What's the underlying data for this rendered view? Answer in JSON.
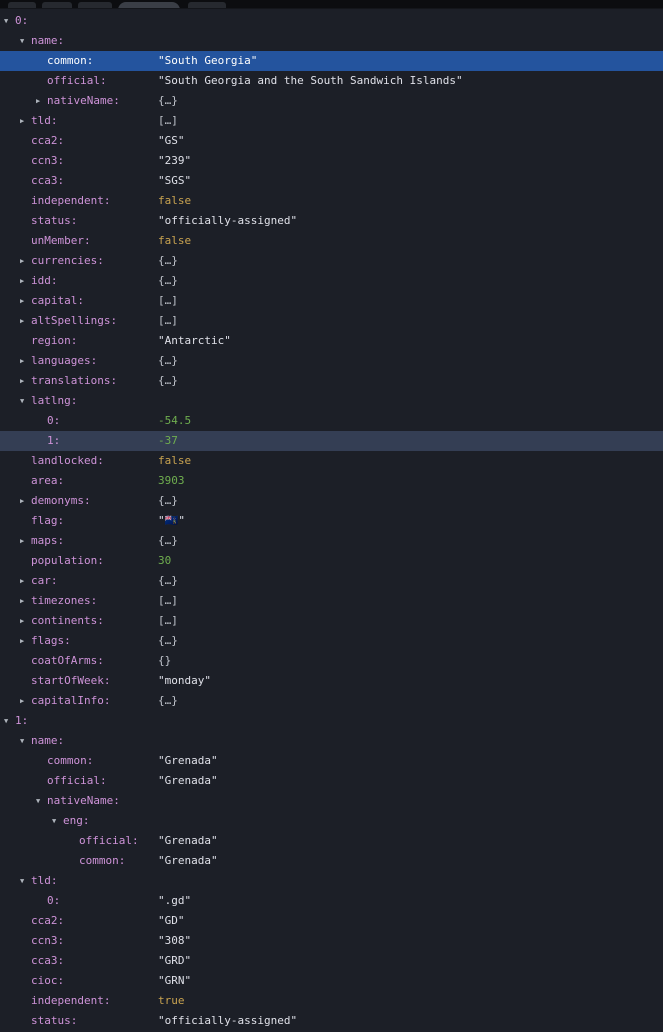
{
  "colors": {
    "background": "#1c1f27",
    "toolbar_background": "#0c0d10",
    "key": "#ce93d8",
    "string": "#dfe0e8",
    "number": "#6fae4f",
    "boolean": "#c9a350",
    "object_placeholder": "#c2c6ce",
    "selection_primary": "#24549e",
    "selection_secondary": "#343e54"
  },
  "icons": {
    "expanded": "▼",
    "collapsed": "▶"
  },
  "tree": {
    "rows": [
      {
        "depth": 0,
        "expander": "open",
        "key": "0:",
        "value": "",
        "type": "none",
        "selected": null
      },
      {
        "depth": 1,
        "expander": "open",
        "key": "name:",
        "value": "",
        "type": "none",
        "selected": null
      },
      {
        "depth": 2,
        "expander": "none",
        "key": "common:",
        "value": "\"South Georgia\"",
        "type": "string",
        "selected": "primary"
      },
      {
        "depth": 2,
        "expander": "none",
        "key": "official:",
        "value": "\"South Georgia and the South Sandwich Islands\"",
        "type": "string",
        "selected": null
      },
      {
        "depth": 2,
        "expander": "closed",
        "key": "nativeName:",
        "value": "{…}",
        "type": "object",
        "selected": null
      },
      {
        "depth": 1,
        "expander": "closed",
        "key": "tld:",
        "value": "[…]",
        "type": "array",
        "selected": null
      },
      {
        "depth": 1,
        "expander": "none",
        "key": "cca2:",
        "value": "\"GS\"",
        "type": "string",
        "selected": null
      },
      {
        "depth": 1,
        "expander": "none",
        "key": "ccn3:",
        "value": "\"239\"",
        "type": "string",
        "selected": null
      },
      {
        "depth": 1,
        "expander": "none",
        "key": "cca3:",
        "value": "\"SGS\"",
        "type": "string",
        "selected": null
      },
      {
        "depth": 1,
        "expander": "none",
        "key": "independent:",
        "value": "false",
        "type": "boolean",
        "selected": null
      },
      {
        "depth": 1,
        "expander": "none",
        "key": "status:",
        "value": "\"officially-assigned\"",
        "type": "string",
        "selected": null
      },
      {
        "depth": 1,
        "expander": "none",
        "key": "unMember:",
        "value": "false",
        "type": "boolean",
        "selected": null
      },
      {
        "depth": 1,
        "expander": "closed",
        "key": "currencies:",
        "value": "{…}",
        "type": "object",
        "selected": null
      },
      {
        "depth": 1,
        "expander": "closed",
        "key": "idd:",
        "value": "{…}",
        "type": "object",
        "selected": null
      },
      {
        "depth": 1,
        "expander": "closed",
        "key": "capital:",
        "value": "[…]",
        "type": "array",
        "selected": null
      },
      {
        "depth": 1,
        "expander": "closed",
        "key": "altSpellings:",
        "value": "[…]",
        "type": "array",
        "selected": null
      },
      {
        "depth": 1,
        "expander": "none",
        "key": "region:",
        "value": "\"Antarctic\"",
        "type": "string",
        "selected": null
      },
      {
        "depth": 1,
        "expander": "closed",
        "key": "languages:",
        "value": "{…}",
        "type": "object",
        "selected": null
      },
      {
        "depth": 1,
        "expander": "closed",
        "key": "translations:",
        "value": "{…}",
        "type": "object",
        "selected": null
      },
      {
        "depth": 1,
        "expander": "open",
        "key": "latlng:",
        "value": "",
        "type": "none",
        "selected": null
      },
      {
        "depth": 2,
        "expander": "none",
        "key": "0:",
        "value": "-54.5",
        "type": "number",
        "selected": null
      },
      {
        "depth": 2,
        "expander": "none",
        "key": "1:",
        "value": "-37",
        "type": "number",
        "selected": "secondary"
      },
      {
        "depth": 1,
        "expander": "none",
        "key": "landlocked:",
        "value": "false",
        "type": "boolean",
        "selected": null
      },
      {
        "depth": 1,
        "expander": "none",
        "key": "area:",
        "value": "3903",
        "type": "number",
        "selected": null
      },
      {
        "depth": 1,
        "expander": "closed",
        "key": "demonyms:",
        "value": "{…}",
        "type": "object",
        "selected": null
      },
      {
        "depth": 1,
        "expander": "none",
        "key": "flag:",
        "value": "\"🇬🇸\"",
        "type": "string",
        "selected": null
      },
      {
        "depth": 1,
        "expander": "closed",
        "key": "maps:",
        "value": "{…}",
        "type": "object",
        "selected": null
      },
      {
        "depth": 1,
        "expander": "none",
        "key": "population:",
        "value": "30",
        "type": "number",
        "selected": null
      },
      {
        "depth": 1,
        "expander": "closed",
        "key": "car:",
        "value": "{…}",
        "type": "object",
        "selected": null
      },
      {
        "depth": 1,
        "expander": "closed",
        "key": "timezones:",
        "value": "[…]",
        "type": "array",
        "selected": null
      },
      {
        "depth": 1,
        "expander": "closed",
        "key": "continents:",
        "value": "[…]",
        "type": "array",
        "selected": null
      },
      {
        "depth": 1,
        "expander": "closed",
        "key": "flags:",
        "value": "{…}",
        "type": "object",
        "selected": null
      },
      {
        "depth": 1,
        "expander": "none",
        "key": "coatOfArms:",
        "value": "{}",
        "type": "object",
        "selected": null
      },
      {
        "depth": 1,
        "expander": "none",
        "key": "startOfWeek:",
        "value": "\"monday\"",
        "type": "string",
        "selected": null
      },
      {
        "depth": 1,
        "expander": "closed",
        "key": "capitalInfo:",
        "value": "{…}",
        "type": "object",
        "selected": null
      },
      {
        "depth": 0,
        "expander": "open",
        "key": "1:",
        "value": "",
        "type": "none",
        "selected": null
      },
      {
        "depth": 1,
        "expander": "open",
        "key": "name:",
        "value": "",
        "type": "none",
        "selected": null
      },
      {
        "depth": 2,
        "expander": "none",
        "key": "common:",
        "value": "\"Grenada\"",
        "type": "string",
        "selected": null
      },
      {
        "depth": 2,
        "expander": "none",
        "key": "official:",
        "value": "\"Grenada\"",
        "type": "string",
        "selected": null
      },
      {
        "depth": 2,
        "expander": "open",
        "key": "nativeName:",
        "value": "",
        "type": "none",
        "selected": null
      },
      {
        "depth": 3,
        "expander": "open",
        "key": "eng:",
        "value": "",
        "type": "none",
        "selected": null
      },
      {
        "depth": 4,
        "expander": "none",
        "key": "official:",
        "value": "\"Grenada\"",
        "type": "string",
        "selected": null
      },
      {
        "depth": 4,
        "expander": "none",
        "key": "common:",
        "value": "\"Grenada\"",
        "type": "string",
        "selected": null
      },
      {
        "depth": 1,
        "expander": "open",
        "key": "tld:",
        "value": "",
        "type": "none",
        "selected": null
      },
      {
        "depth": 2,
        "expander": "none",
        "key": "0:",
        "value": "\".gd\"",
        "type": "string",
        "selected": null
      },
      {
        "depth": 1,
        "expander": "none",
        "key": "cca2:",
        "value": "\"GD\"",
        "type": "string",
        "selected": null
      },
      {
        "depth": 1,
        "expander": "none",
        "key": "ccn3:",
        "value": "\"308\"",
        "type": "string",
        "selected": null
      },
      {
        "depth": 1,
        "expander": "none",
        "key": "cca3:",
        "value": "\"GRD\"",
        "type": "string",
        "selected": null
      },
      {
        "depth": 1,
        "expander": "none",
        "key": "cioc:",
        "value": "\"GRN\"",
        "type": "string",
        "selected": null
      },
      {
        "depth": 1,
        "expander": "none",
        "key": "independent:",
        "value": "true",
        "type": "boolean",
        "selected": null
      },
      {
        "depth": 1,
        "expander": "none",
        "key": "status:",
        "value": "\"officially-assigned\"",
        "type": "string",
        "selected": null
      }
    ]
  }
}
